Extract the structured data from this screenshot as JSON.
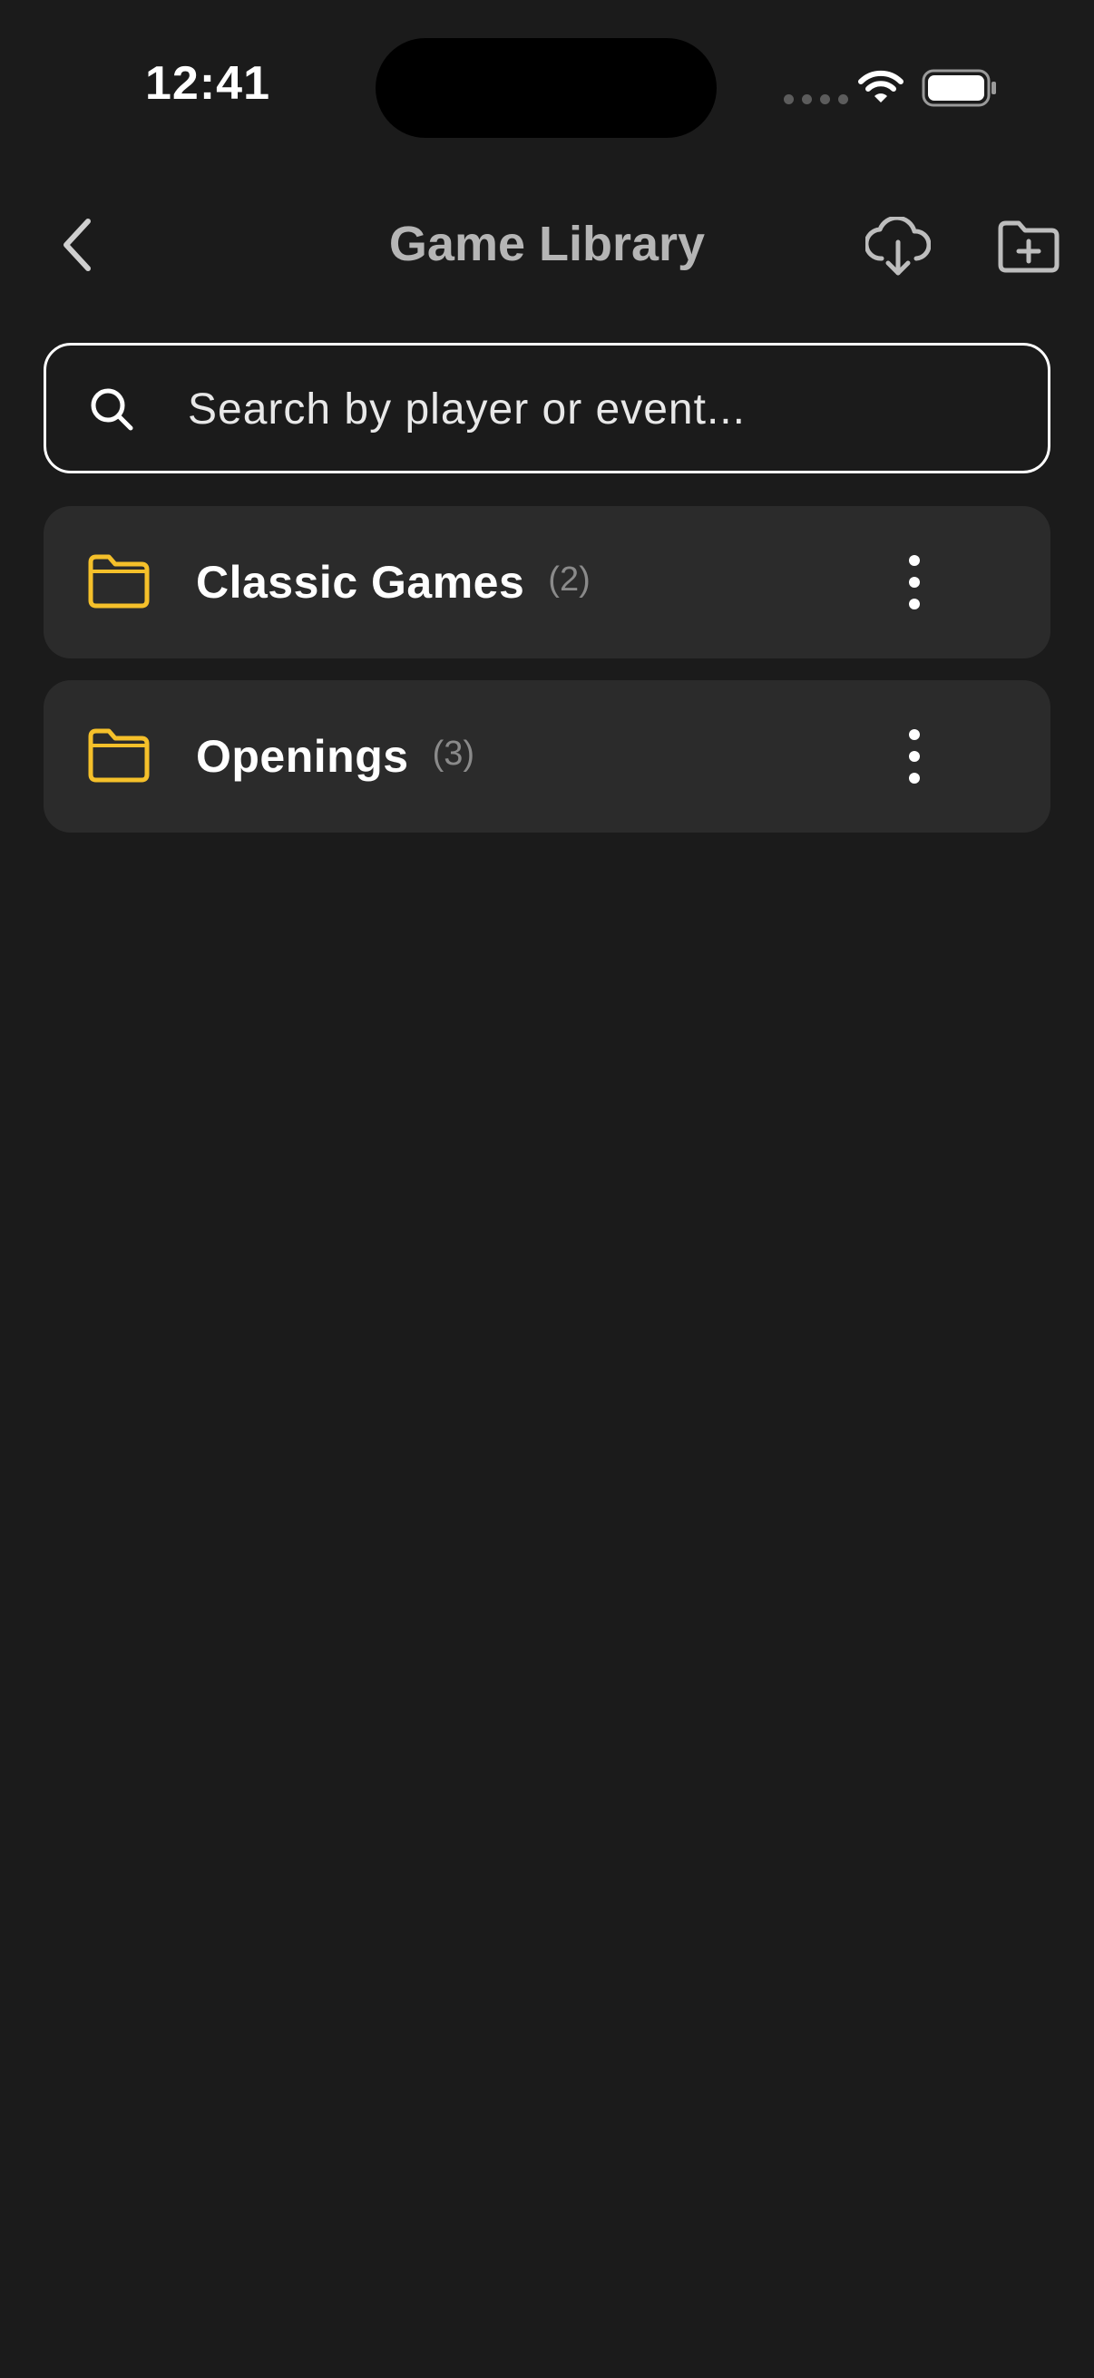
{
  "status_bar": {
    "time": "12:41",
    "icons": [
      "cellular-dots-icon",
      "wifi-icon",
      "battery-icon"
    ]
  },
  "nav": {
    "title": "Game Library",
    "back_icon": "chevron-left-icon",
    "import_icon": "cloud-download-icon",
    "new_folder_icon": "folder-plus-icon"
  },
  "search": {
    "placeholder": "Search by player or event...",
    "value": "",
    "icon": "search-icon"
  },
  "folders": [
    {
      "name": "Classic Games",
      "count": "(2)",
      "icon": "folder-icon",
      "menu_icon": "more-vertical-icon"
    },
    {
      "name": "Openings",
      "count": "(3)",
      "icon": "folder-icon",
      "menu_icon": "more-vertical-icon"
    }
  ],
  "colors": {
    "background": "#1b1b1b",
    "card": "#2b2b2b",
    "folder_accent": "#f5c02a",
    "title": "#b5b5b5",
    "count": "#8a8a8a"
  }
}
